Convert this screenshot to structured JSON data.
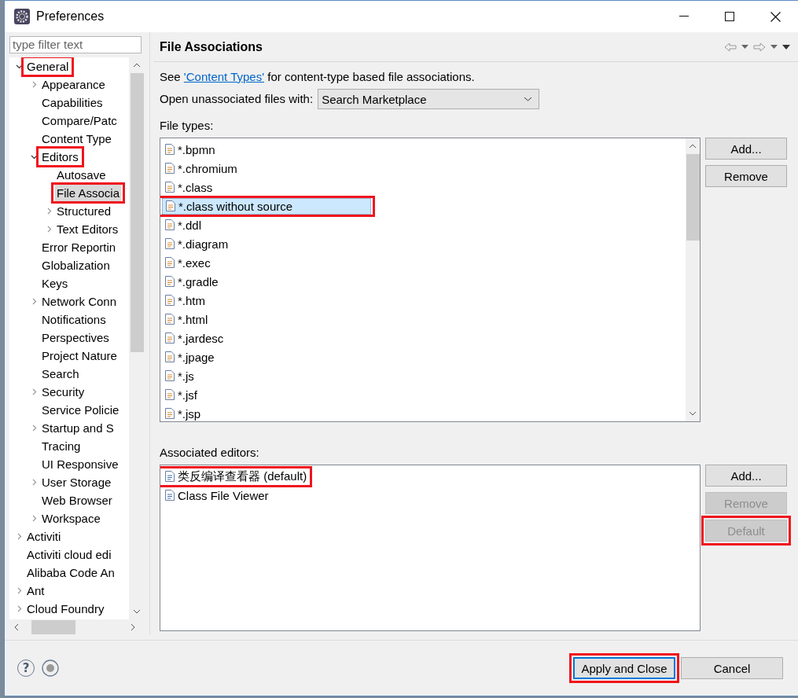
{
  "window": {
    "title": "Preferences"
  },
  "filter": {
    "placeholder": "type filter text"
  },
  "tree": [
    {
      "label": "General",
      "expandable": true,
      "expanded": true,
      "selected": false,
      "annotated": true,
      "children": [
        {
          "label": "Appearance",
          "expandable": true,
          "expanded": false,
          "selected": false,
          "annotated": false
        },
        {
          "label": "Capabilities",
          "expandable": false,
          "selected": false,
          "annotated": false
        },
        {
          "label": "Compare/Patc",
          "expandable": false,
          "selected": false,
          "annotated": false
        },
        {
          "label": "Content Type",
          "expandable": false,
          "selected": false,
          "annotated": false
        },
        {
          "label": "Editors",
          "expandable": true,
          "expanded": true,
          "selected": false,
          "annotated": true,
          "children": [
            {
              "label": "Autosave",
              "expandable": false,
              "selected": false,
              "annotated": false
            },
            {
              "label": "File Associa",
              "expandable": false,
              "selected": true,
              "annotated": true
            },
            {
              "label": "Structured",
              "expandable": true,
              "expanded": false,
              "selected": false,
              "annotated": false
            },
            {
              "label": "Text Editors",
              "expandable": true,
              "expanded": false,
              "selected": false,
              "annotated": false
            }
          ]
        },
        {
          "label": "Error Reportin",
          "expandable": false,
          "selected": false,
          "annotated": false
        },
        {
          "label": "Globalization",
          "expandable": false,
          "selected": false,
          "annotated": false
        },
        {
          "label": "Keys",
          "expandable": false,
          "selected": false,
          "annotated": false
        },
        {
          "label": "Network Conn",
          "expandable": true,
          "expanded": false,
          "selected": false,
          "annotated": false
        },
        {
          "label": "Notifications",
          "expandable": false,
          "selected": false,
          "annotated": false
        },
        {
          "label": "Perspectives",
          "expandable": false,
          "selected": false,
          "annotated": false
        },
        {
          "label": "Project Nature",
          "expandable": false,
          "selected": false,
          "annotated": false
        },
        {
          "label": "Search",
          "expandable": false,
          "selected": false,
          "annotated": false
        },
        {
          "label": "Security",
          "expandable": true,
          "expanded": false,
          "selected": false,
          "annotated": false
        },
        {
          "label": "Service Policie",
          "expandable": false,
          "selected": false,
          "annotated": false
        },
        {
          "label": "Startup and S",
          "expandable": true,
          "expanded": false,
          "selected": false,
          "annotated": false
        },
        {
          "label": "Tracing",
          "expandable": false,
          "selected": false,
          "annotated": false
        },
        {
          "label": "UI Responsive",
          "expandable": false,
          "selected": false,
          "annotated": false
        },
        {
          "label": "User Storage",
          "expandable": true,
          "expanded": false,
          "selected": false,
          "annotated": false
        },
        {
          "label": "Web Browser",
          "expandable": false,
          "selected": false,
          "annotated": false
        },
        {
          "label": "Workspace",
          "expandable": true,
          "expanded": false,
          "selected": false,
          "annotated": false
        }
      ]
    },
    {
      "label": "Activiti",
      "expandable": true,
      "expanded": false,
      "selected": false,
      "annotated": false
    },
    {
      "label": "Activiti cloud edi",
      "expandable": false,
      "selected": false,
      "annotated": false
    },
    {
      "label": "Alibaba Code An",
      "expandable": false,
      "selected": false,
      "annotated": false
    },
    {
      "label": "Ant",
      "expandable": true,
      "expanded": false,
      "selected": false,
      "annotated": false
    },
    {
      "label": "Cloud Foundry",
      "expandable": true,
      "expanded": false,
      "selected": false,
      "annotated": false
    }
  ],
  "page": {
    "title": "File Associations",
    "intro": {
      "before": "See ",
      "link": "'Content Types'",
      "after": " for content-type based file associations."
    },
    "open_with": {
      "label": "Open unassociated files with:",
      "value": "Search Marketplace"
    },
    "file_types": {
      "label": "File types:",
      "items": [
        {
          "label": "*.bpmn",
          "selected": false,
          "annotated": false
        },
        {
          "label": "*.chromium",
          "selected": false,
          "annotated": false
        },
        {
          "label": "*.class",
          "selected": false,
          "annotated": false
        },
        {
          "label": "*.class without source",
          "selected": true,
          "annotated": true
        },
        {
          "label": "*.ddl",
          "selected": false,
          "annotated": false
        },
        {
          "label": "*.diagram",
          "selected": false,
          "annotated": false
        },
        {
          "label": "*.exec",
          "selected": false,
          "annotated": false
        },
        {
          "label": "*.gradle",
          "selected": false,
          "annotated": false
        },
        {
          "label": "*.htm",
          "selected": false,
          "annotated": false
        },
        {
          "label": "*.html",
          "selected": false,
          "annotated": false
        },
        {
          "label": "*.jardesc",
          "selected": false,
          "annotated": false
        },
        {
          "label": "*.jpage",
          "selected": false,
          "annotated": false
        },
        {
          "label": "*.js",
          "selected": false,
          "annotated": false
        },
        {
          "label": "*.jsf",
          "selected": false,
          "annotated": false
        },
        {
          "label": "*.jsp",
          "selected": false,
          "annotated": false
        }
      ],
      "buttons": [
        {
          "label": "Add...",
          "disabled": false,
          "annotated": false
        },
        {
          "label": "Remove",
          "disabled": false,
          "annotated": false
        }
      ]
    },
    "editors": {
      "label": "Associated editors:",
      "items": [
        {
          "label": "类反编译查看器 (default)",
          "selected": false,
          "annotated": true
        },
        {
          "label": "Class File Viewer",
          "selected": false,
          "annotated": false
        }
      ],
      "buttons": [
        {
          "label": "Add...",
          "disabled": false,
          "annotated": false
        },
        {
          "label": "Remove",
          "disabled": true,
          "annotated": false
        },
        {
          "label": "Default",
          "disabled": true,
          "annotated": true
        }
      ]
    }
  },
  "footer": {
    "help": "?",
    "buttons": [
      {
        "label": "Apply and Close",
        "default": true,
        "annotated": true
      },
      {
        "label": "Cancel",
        "default": false,
        "annotated": false
      }
    ]
  }
}
